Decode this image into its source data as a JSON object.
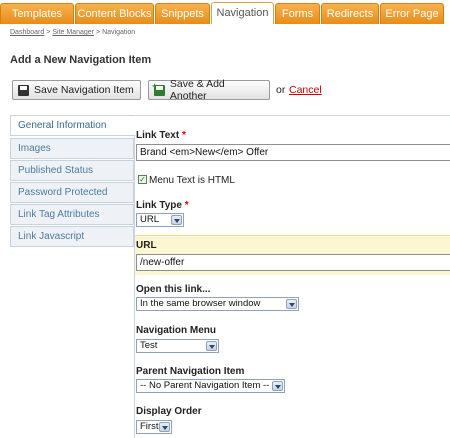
{
  "tabs": [
    {
      "label": "Templates"
    },
    {
      "label": "Content Blocks"
    },
    {
      "label": "Snippets"
    },
    {
      "label": "Navigation"
    },
    {
      "label": "Forms"
    },
    {
      "label": "Redirects"
    },
    {
      "label": "Error Page"
    }
  ],
  "active_tab": "Navigation",
  "breadcrumb": {
    "items": [
      "Dashboard",
      "Site Manager",
      "Navigation"
    ],
    "separator": ">"
  },
  "page_title": "Add a New Navigation Item",
  "actions": {
    "save_label": "Save Navigation Item",
    "save_add_label": "Save & Add Another",
    "or_text": "or",
    "cancel_label": "Cancel"
  },
  "sidebar": {
    "items": [
      {
        "label": "General Information",
        "active": true
      },
      {
        "label": "Images"
      },
      {
        "label": "Published Status"
      },
      {
        "label": "Password Protected"
      },
      {
        "label": "Link Tag Attributes"
      },
      {
        "label": "Link Javascript"
      }
    ]
  },
  "form": {
    "link_text": {
      "label": "Link Text",
      "required_mark": "*",
      "value": "Brand <em>New</em> Offer"
    },
    "menu_text_html": {
      "label": "Menu Text is HTML",
      "checked": true
    },
    "link_type": {
      "label": "Link Type",
      "required_mark": "*",
      "value": "URL"
    },
    "url": {
      "label": "URL",
      "value": "/new-offer"
    },
    "open_link": {
      "label": "Open this link...",
      "value": "In the same browser window"
    },
    "nav_menu": {
      "label": "Navigation Menu",
      "value": "Test"
    },
    "parent_item": {
      "label": "Parent Navigation Item",
      "value": "-- No Parent Navigation Item --"
    },
    "display_order": {
      "label": "Display Order",
      "value": "First"
    }
  },
  "colors": {
    "tab_orange": "#e88c1b",
    "sidebar_text": "#4d7aa0",
    "url_highlight": "#fdf6d3",
    "cancel_red": "#cc0000",
    "required_red": "#dd0000"
  }
}
